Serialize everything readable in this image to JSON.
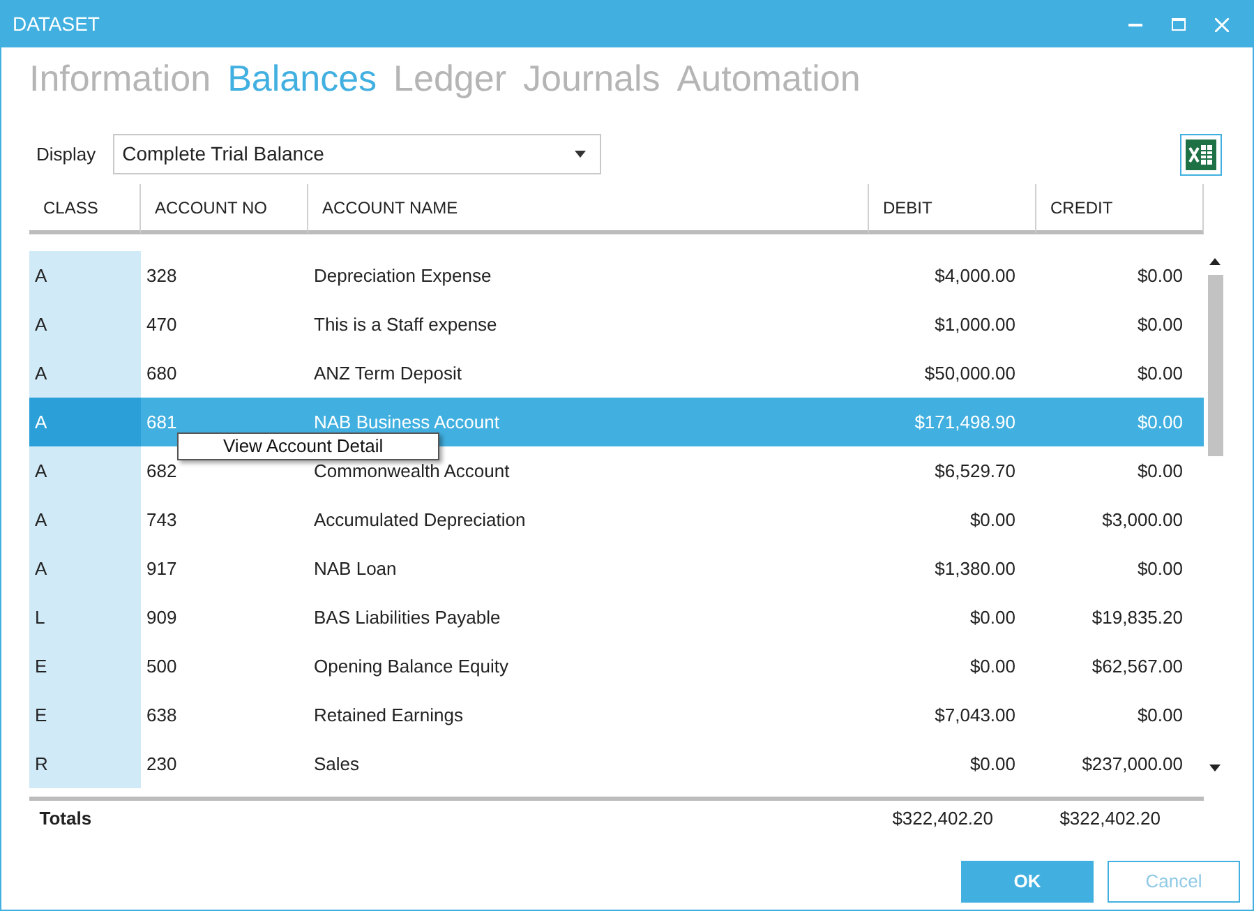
{
  "window": {
    "title": "DATASET"
  },
  "tabs": [
    {
      "label": "Information",
      "selected": false
    },
    {
      "label": "Balances",
      "selected": true
    },
    {
      "label": "Ledger",
      "selected": false
    },
    {
      "label": "Journals",
      "selected": false
    },
    {
      "label": "Automation",
      "selected": false
    }
  ],
  "display": {
    "label": "Display",
    "value": "Complete Trial Balance"
  },
  "table": {
    "columns": [
      "CLASS",
      "ACCOUNT NO",
      "ACCOUNT NAME",
      "DEBIT",
      "CREDIT"
    ],
    "rows": [
      {
        "class": "A",
        "account_no": "328",
        "account_name": "Depreciation Expense",
        "debit": "$4,000.00",
        "credit": "$0.00",
        "selected": false
      },
      {
        "class": "A",
        "account_no": "470",
        "account_name": "This is a Staff expense",
        "debit": "$1,000.00",
        "credit": "$0.00",
        "selected": false
      },
      {
        "class": "A",
        "account_no": "680",
        "account_name": "ANZ Term Deposit",
        "debit": "$50,000.00",
        "credit": "$0.00",
        "selected": false
      },
      {
        "class": "A",
        "account_no": "681",
        "account_name": "NAB Business Account",
        "debit": "$171,498.90",
        "credit": "$0.00",
        "selected": true
      },
      {
        "class": "A",
        "account_no": "682",
        "account_name": "Commonwealth Account",
        "debit": "$6,529.70",
        "credit": "$0.00",
        "selected": false
      },
      {
        "class": "A",
        "account_no": "743",
        "account_name": "Accumulated Depreciation",
        "debit": "$0.00",
        "credit": "$3,000.00",
        "selected": false
      },
      {
        "class": "A",
        "account_no": "917",
        "account_name": "NAB Loan",
        "debit": "$1,380.00",
        "credit": "$0.00",
        "selected": false
      },
      {
        "class": "L",
        "account_no": "909",
        "account_name": "BAS Liabilities Payable",
        "debit": "$0.00",
        "credit": "$19,835.20",
        "selected": false
      },
      {
        "class": "E",
        "account_no": "500",
        "account_name": "Opening Balance Equity",
        "debit": "$0.00",
        "credit": "$62,567.00",
        "selected": false
      },
      {
        "class": "E",
        "account_no": "638",
        "account_name": "Retained Earnings",
        "debit": "$7,043.00",
        "credit": "$0.00",
        "selected": false
      },
      {
        "class": "R",
        "account_no": "230",
        "account_name": "Sales",
        "debit": "$0.00",
        "credit": "$237,000.00",
        "selected": false
      }
    ],
    "totals": {
      "label": "Totals",
      "debit": "$322,402.20",
      "credit": "$322,402.20"
    }
  },
  "context_menu": {
    "items": [
      "View Account Detail"
    ]
  },
  "buttons": [
    "OK",
    "Cancel"
  ]
}
